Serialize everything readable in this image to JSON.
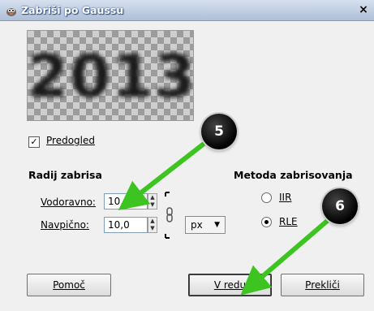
{
  "window": {
    "title": "Zabriši po Gaussu",
    "close_glyph": "×"
  },
  "preview": {
    "image_text": "2013",
    "checkbox_label": "Predogled",
    "checked": true
  },
  "blur_radius": {
    "heading": "Radij zabrisa",
    "horizontal_label": "Vodoravno:",
    "horizontal_value": "10,0",
    "vertical_label": "Navpično:",
    "vertical_value": "10,0",
    "unit": "px"
  },
  "method": {
    "heading": "Metoda zabrisovanja",
    "options": [
      {
        "label": "IIR",
        "selected": false
      },
      {
        "label": "RLE",
        "selected": true
      }
    ]
  },
  "buttons": {
    "help": "Pomoč",
    "ok": "V redu",
    "cancel": "Prekliči"
  },
  "annotations": {
    "badge_1": "5",
    "badge_2": "6",
    "arrow_color": "#3ec421"
  }
}
